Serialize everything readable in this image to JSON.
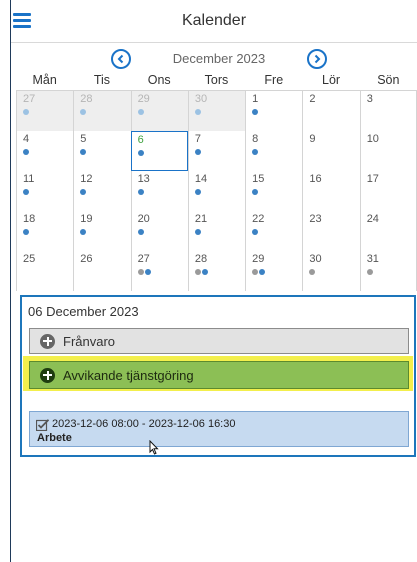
{
  "header": {
    "title": "Kalender"
  },
  "month_nav": {
    "label": "December 2023"
  },
  "weekdays": [
    "Mån",
    "Tis",
    "Ons",
    "Tors",
    "Fre",
    "Lör",
    "Sön"
  ],
  "weeks": [
    [
      {
        "day": "27",
        "other": true,
        "dots": [
          "#9cc2e3"
        ]
      },
      {
        "day": "28",
        "other": true,
        "dots": [
          "#9cc2e3"
        ]
      },
      {
        "day": "29",
        "other": true,
        "dots": [
          "#9cc2e3"
        ]
      },
      {
        "day": "30",
        "other": true,
        "dots": [
          "#9cc2e3"
        ]
      },
      {
        "day": "1",
        "other": false,
        "dots": [
          "#3b82c4"
        ]
      },
      {
        "day": "2",
        "other": false,
        "dots": []
      },
      {
        "day": "3",
        "other": false,
        "dots": []
      }
    ],
    [
      {
        "day": "4",
        "other": false,
        "dots": [
          "#3b82c4"
        ]
      },
      {
        "day": "5",
        "other": false,
        "dots": [
          "#3b82c4"
        ]
      },
      {
        "day": "6",
        "other": false,
        "today": true,
        "dots": [
          "#3b82c4"
        ]
      },
      {
        "day": "7",
        "other": false,
        "dots": [
          "#3b82c4"
        ]
      },
      {
        "day": "8",
        "other": false,
        "dots": [
          "#3b82c4"
        ]
      },
      {
        "day": "9",
        "other": false,
        "dots": []
      },
      {
        "day": "10",
        "other": false,
        "dots": []
      }
    ],
    [
      {
        "day": "11",
        "other": false,
        "dots": [
          "#3b82c4"
        ]
      },
      {
        "day": "12",
        "other": false,
        "dots": [
          "#3b82c4"
        ]
      },
      {
        "day": "13",
        "other": false,
        "dots": [
          "#3b82c4"
        ]
      },
      {
        "day": "14",
        "other": false,
        "dots": [
          "#3b82c4"
        ]
      },
      {
        "day": "15",
        "other": false,
        "dots": [
          "#3b82c4"
        ]
      },
      {
        "day": "16",
        "other": false,
        "dots": []
      },
      {
        "day": "17",
        "other": false,
        "dots": []
      }
    ],
    [
      {
        "day": "18",
        "other": false,
        "dots": [
          "#3b82c4"
        ]
      },
      {
        "day": "19",
        "other": false,
        "dots": [
          "#3b82c4"
        ]
      },
      {
        "day": "20",
        "other": false,
        "dots": [
          "#3b82c4"
        ]
      },
      {
        "day": "21",
        "other": false,
        "dots": [
          "#3b82c4"
        ]
      },
      {
        "day": "22",
        "other": false,
        "dots": [
          "#3b82c4"
        ]
      },
      {
        "day": "23",
        "other": false,
        "dots": []
      },
      {
        "day": "24",
        "other": false,
        "dots": []
      }
    ],
    [
      {
        "day": "25",
        "other": false,
        "dots": []
      },
      {
        "day": "26",
        "other": false,
        "dots": []
      },
      {
        "day": "27",
        "other": false,
        "dots": [
          "#9a9a9a",
          "#3b82c4"
        ]
      },
      {
        "day": "28",
        "other": false,
        "dots": [
          "#9a9a9a",
          "#3b82c4"
        ]
      },
      {
        "day": "29",
        "other": false,
        "dots": [
          "#9a9a9a",
          "#3b82c4"
        ]
      },
      {
        "day": "30",
        "other": false,
        "dots": [
          "#9a9a9a"
        ]
      },
      {
        "day": "31",
        "other": false,
        "dots": [
          "#9a9a9a"
        ]
      }
    ]
  ],
  "panel": {
    "date_label": "06 December 2023",
    "franvaro_label": "Frånvaro",
    "avvikande_label": "Avvikande tjänstgöring",
    "entry": {
      "range": "2023-12-06 08:00 - 2023-12-06 16:30",
      "type": "Arbete"
    }
  },
  "icons": {
    "menu": "hamburger-menu-icon",
    "prev": "chevron-left-circle-icon",
    "next": "chevron-right-circle-icon",
    "add": "plus-circle-icon",
    "entry": "checkbox-edit-icon"
  },
  "colors": {
    "accent": "#1a73c8",
    "today_text": "#3ea13e",
    "highlight": "#f3ef4c",
    "avvikande_bg": "#8cbf55",
    "entry_bg": "#c6daf0"
  }
}
